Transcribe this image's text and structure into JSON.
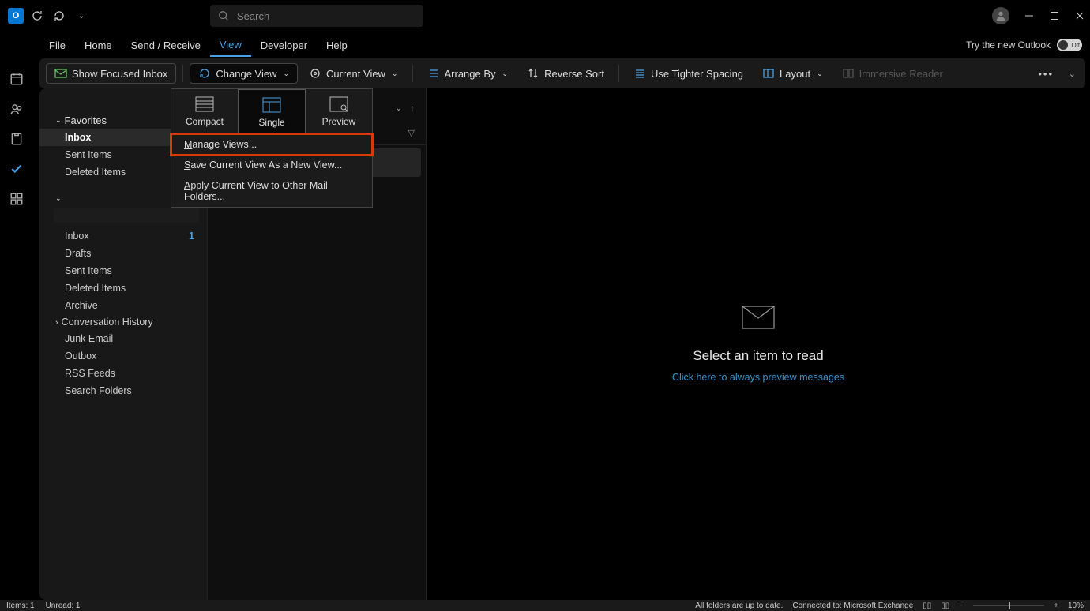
{
  "titlebar": {
    "search_placeholder": "Search"
  },
  "menu": {
    "items": [
      "File",
      "Home",
      "Send / Receive",
      "View",
      "Developer",
      "Help"
    ],
    "active_index": 3,
    "try_label": "Try the new Outlook",
    "toggle_state": "Off"
  },
  "ribbon": {
    "focused": "Show Focused Inbox",
    "change_view": "Change View",
    "current_view": "Current View",
    "arrange_by": "Arrange By",
    "reverse_sort": "Reverse Sort",
    "tighter": "Use Tighter Spacing",
    "layout": "Layout",
    "immersive": "Immersive Reader"
  },
  "dropdown": {
    "opts": [
      "Compact",
      "Single",
      "Preview"
    ],
    "selected_index": 1,
    "items": [
      "Manage Views...",
      "Save Current View As a New View...",
      "Apply Current View to Other Mail Folders..."
    ],
    "highlight_index": 0
  },
  "folderpane": {
    "favorites_label": "Favorites",
    "favorites": [
      {
        "label": "Inbox",
        "selected": true,
        "bold": true
      },
      {
        "label": "Sent Items"
      },
      {
        "label": "Deleted Items"
      }
    ],
    "account_items": [
      {
        "label": "Inbox",
        "badge": "1"
      },
      {
        "label": "Drafts"
      },
      {
        "label": "Sent Items"
      },
      {
        "label": "Deleted Items"
      },
      {
        "label": "Archive"
      },
      {
        "label": "Conversation History",
        "expandable": true
      },
      {
        "label": "Junk Email"
      },
      {
        "label": "Outbox"
      },
      {
        "label": "RSS Feeds"
      },
      {
        "label": "Search Folders"
      }
    ]
  },
  "readpane": {
    "title": "Select an item to read",
    "link": "Click here to always preview messages"
  },
  "statusbar": {
    "items": "Items: 1",
    "unread": "Unread: 1",
    "uptodate": "All folders are up to date.",
    "connected": "Connected to: Microsoft Exchange",
    "zoom": "10%"
  }
}
